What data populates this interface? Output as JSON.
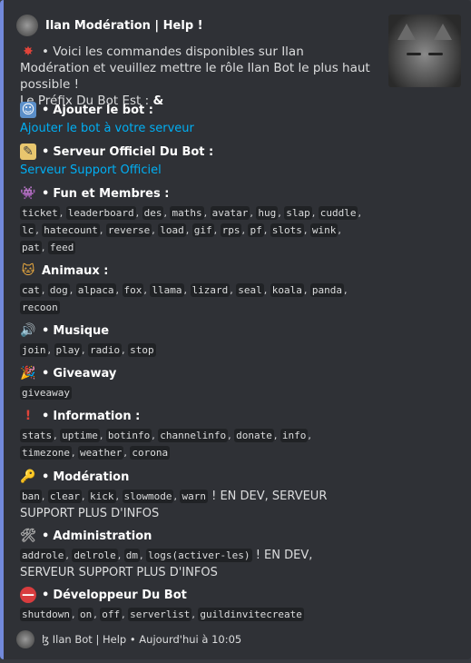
{
  "author": {
    "name": "Ilan Modération | Help !"
  },
  "description": {
    "line1": "Voici les commandes disponibles sur Ilan Modération et veuillez mettre le rôle Ilan Bot le plus haut possible !",
    "prefix_label": "Le Préfix Du Bot Est : ",
    "prefix_value": "&"
  },
  "fields": {
    "add_bot": {
      "title": "Ajouter le bot :",
      "link": "Ajouter le bot à votre serveur"
    },
    "official_server": {
      "title": "Serveur Officiel Du Bot :",
      "link": "Serveur Support Officiel"
    },
    "fun": {
      "title": "Fun et Membres :",
      "commands": [
        "ticket",
        "leaderboard",
        "des",
        "maths",
        "avatar",
        "hug",
        "slap",
        "cuddle",
        "lc",
        "hatecount",
        "reverse",
        "load",
        "gif",
        "rps",
        "pf",
        "slots",
        "wink",
        "pat",
        "feed"
      ]
    },
    "animals": {
      "title": "Animaux :",
      "commands": [
        "cat",
        "dog",
        "alpaca",
        "fox",
        "llama",
        "lizard",
        "seal",
        "koala",
        "panda",
        "recoon"
      ]
    },
    "music": {
      "title": "Musique",
      "commands": [
        "join",
        "play",
        "radio",
        "stop"
      ]
    },
    "giveaway": {
      "title": "Giveaway",
      "commands": [
        "giveaway"
      ]
    },
    "information": {
      "title": "Information :",
      "commands": [
        "stats",
        "uptime",
        "botinfo",
        "channelinfo",
        "donate",
        "info",
        "timezone",
        "weather",
        "corona"
      ]
    },
    "moderation": {
      "title": "Modération",
      "commands": [
        "ban",
        "clear",
        "kick",
        "slowmode",
        "warn"
      ],
      "note": "! EN DEV, SERVEUR SUPPORT PLUS D'INFOS"
    },
    "administration": {
      "title": "Administration",
      "commands": [
        "addrole",
        "delrole",
        "dm",
        "logs(activer-les)"
      ],
      "note": "! EN DEV, SERVEUR SUPPORT PLUS D'INFOS"
    },
    "developer": {
      "title": "Développeur Du Bot",
      "commands": [
        "shutdown",
        "on",
        "off",
        "serverlist",
        "guildinvitecreate"
      ]
    }
  },
  "footer": {
    "text": "ɮ Ilan Bot | Help • Aujourd'hui à 10:05"
  },
  "colors": {
    "embed_border": "#7289da",
    "embed_bg": "#2f3136",
    "link": "#00aff4"
  },
  "icons": {
    "description": "collision-icon",
    "add_bot": "robot-icon",
    "official_server": "memo-icon",
    "fun": "alien-icon",
    "animals": "cat-icon",
    "music": "speaker-icon",
    "giveaway": "party-popper-icon",
    "information": "exclamation-icon",
    "moderation": "key-icon",
    "administration": "tools-icon",
    "developer": "no-entry-icon"
  }
}
